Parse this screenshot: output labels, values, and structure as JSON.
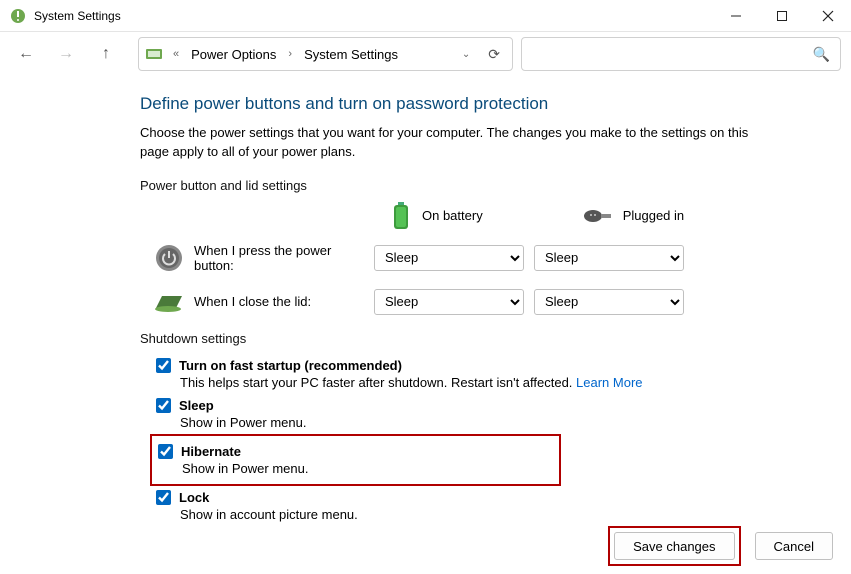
{
  "window": {
    "title": "System Settings"
  },
  "nav": {
    "breadcrumb": {
      "root_marker": "«",
      "item1": "Power Options",
      "item2": "System Settings"
    }
  },
  "search": {
    "placeholder": ""
  },
  "main": {
    "heading": "Define power buttons and turn on password protection",
    "description": "Choose the power settings that you want for your computer. The changes you make to the settings on this page apply to all of your power plans.",
    "pb_section_label": "Power button and lid settings",
    "col_battery": "On battery",
    "col_plugged": "Plugged in",
    "row_power_label": "When I press the power button:",
    "row_lid_label": "When I close the lid:",
    "sel_power_battery": "Sleep",
    "sel_power_plugged": "Sleep",
    "sel_lid_battery": "Sleep",
    "sel_lid_plugged": "Sleep",
    "shutdown_label": "Shutdown settings",
    "fast_startup": {
      "label": "Turn on fast startup (recommended)",
      "sub_prefix": "This helps start your PC faster after shutdown. Restart isn't affected. ",
      "learn_more": "Learn More"
    },
    "sleep": {
      "label": "Sleep",
      "sub": "Show in Power menu."
    },
    "hibernate": {
      "label": "Hibernate",
      "sub": "Show in Power menu."
    },
    "lock": {
      "label": "Lock",
      "sub": "Show in account picture menu."
    }
  },
  "footer": {
    "save": "Save changes",
    "cancel": "Cancel"
  }
}
